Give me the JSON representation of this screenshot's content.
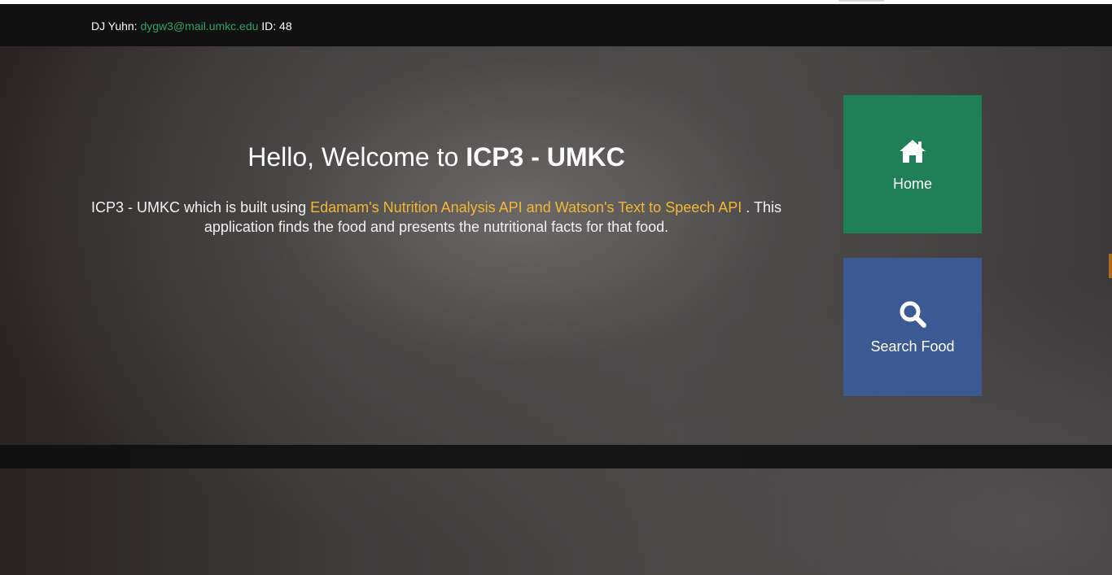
{
  "header": {
    "name_label": "DJ Yuhn:",
    "email": "dygw3@mail.umkc.edu",
    "id_label": "ID: 48"
  },
  "hero": {
    "title_prefix": "Hello, Welcome to ",
    "title_brand": "ICP3 - UMKC",
    "text_before": "ICP3 - UMKC which is built using ",
    "text_apis": "Edamam's Nutrition Analysis API and Watson's Text to Speech API",
    "text_after": " . This application finds the food and presents the nutritional facts for that food."
  },
  "tiles": [
    {
      "label": "Home",
      "icon": "home-icon",
      "color": "#1f7f57"
    },
    {
      "label": "Search Food",
      "icon": "search-icon",
      "color": "#3b5a93"
    }
  ],
  "colors": {
    "header_bg": "#121111",
    "email_link": "#2fa068",
    "api_link": "#f4b731"
  }
}
